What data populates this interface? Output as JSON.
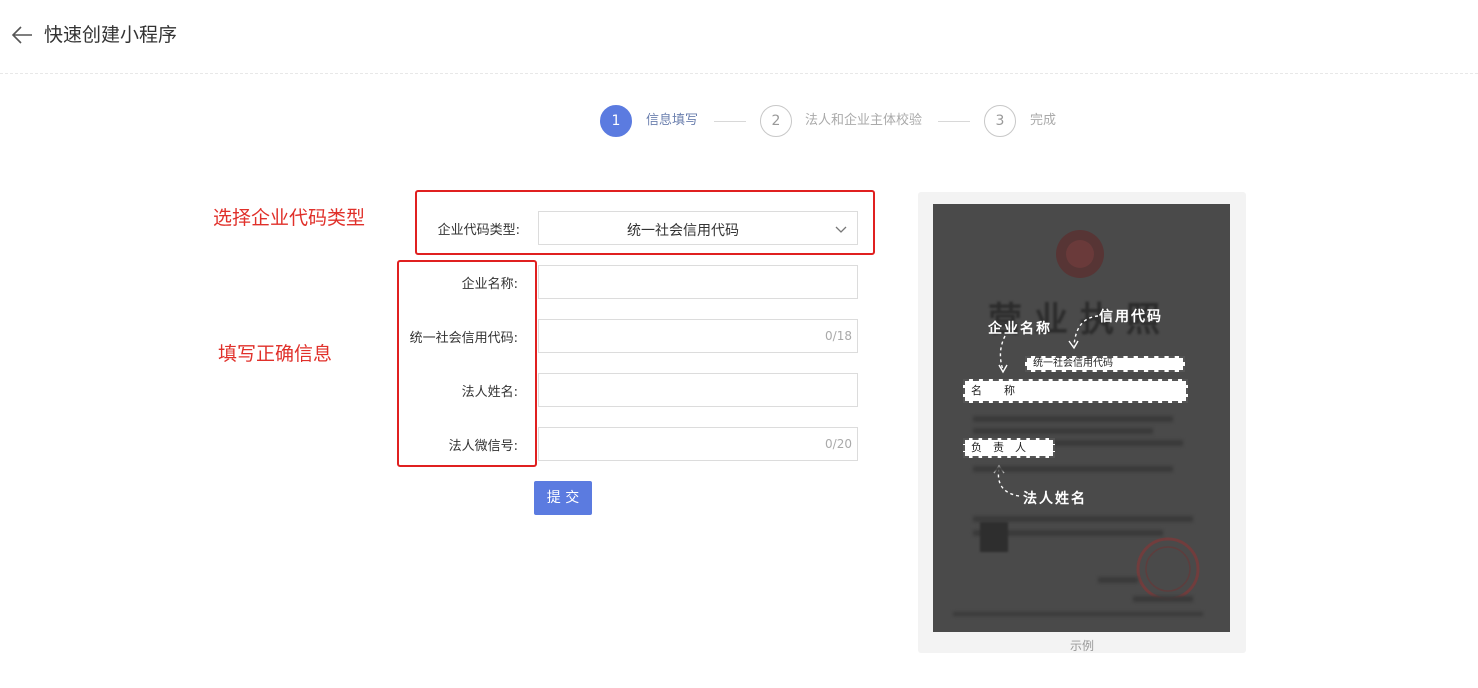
{
  "header": {
    "title": "快速创建小程序",
    "back_icon": "arrow-left-icon"
  },
  "steps": [
    {
      "num": "1",
      "label": "信息填写",
      "active": true
    },
    {
      "num": "2",
      "label": "法人和企业主体校验",
      "active": false
    },
    {
      "num": "3",
      "label": "完成",
      "active": false
    }
  ],
  "annotations": {
    "select_type": "选择企业代码类型",
    "fill_info": "填写正确信息",
    "color": "#e0302a"
  },
  "form": {
    "code_type": {
      "label": "企业代码类型:",
      "value": "统一社会信用代码"
    },
    "company_name": {
      "label": "企业名称:",
      "value": ""
    },
    "credit_code": {
      "label": "统一社会信用代码:",
      "value": "",
      "counter": "0/18"
    },
    "legal_name": {
      "label": "法人姓名:",
      "value": ""
    },
    "legal_wechat": {
      "label": "法人微信号:",
      "value": "",
      "counter": "0/20"
    },
    "submit": "提 交"
  },
  "sample": {
    "caption": "示例",
    "title": "营业执照",
    "hand_company_name": "企业名称",
    "hand_credit_code": "信用代码",
    "hand_legal_name": "法人姓名",
    "box_credit_code": "统一社会信用代码",
    "box_name": "名　　称",
    "box_person": "负　责　人"
  },
  "colors": {
    "accent": "#5b7be0",
    "annotation_red": "#e02020"
  }
}
